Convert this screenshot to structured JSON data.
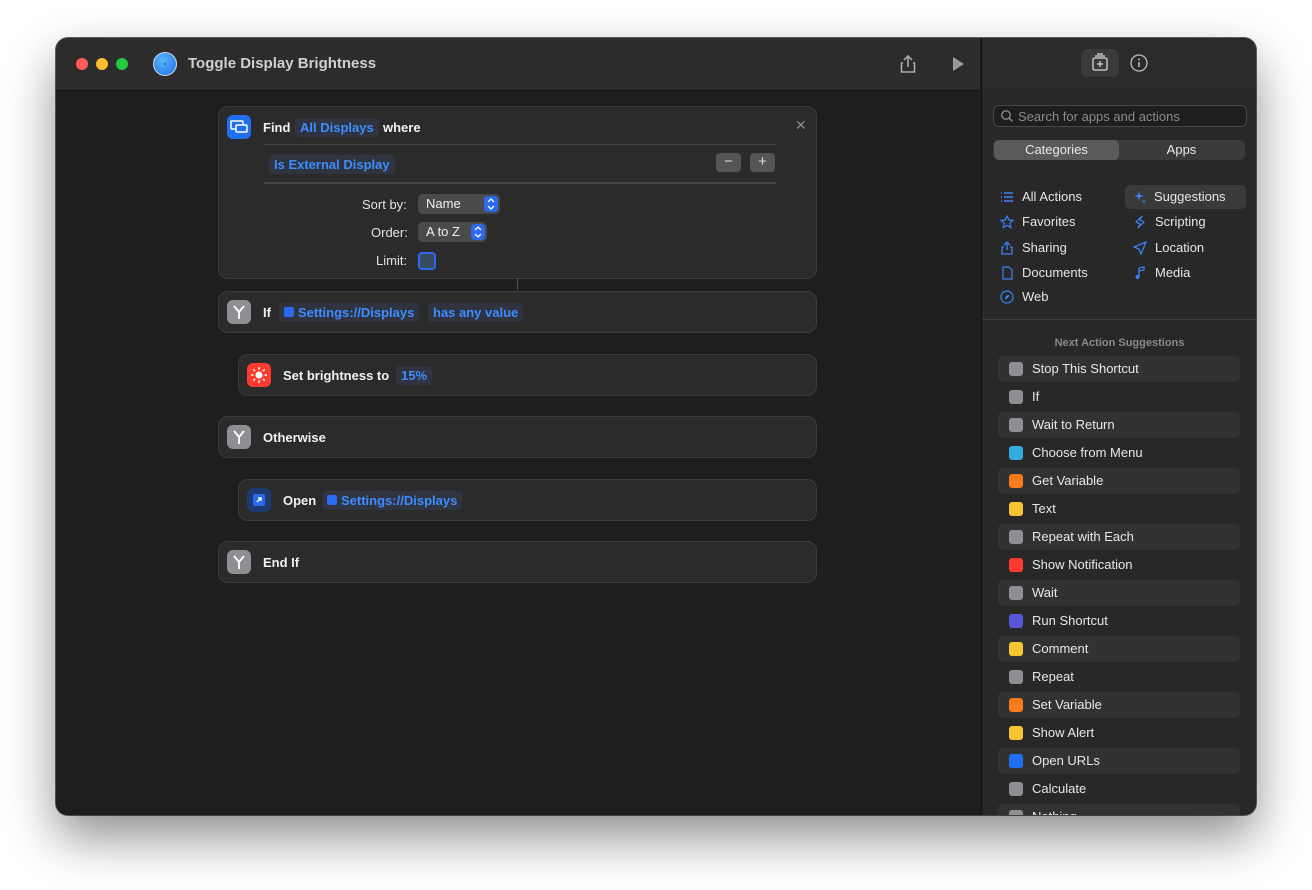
{
  "window": {
    "title": "Toggle Display Brightness"
  },
  "workflow": {
    "find": {
      "keyword": "Find",
      "subject": "All Displays",
      "where": "where",
      "filter": "Is External Display",
      "sort_label": "Sort by:",
      "sort_value": "Name",
      "order_label": "Order:",
      "order_value": "A to Z",
      "limit_label": "Limit:"
    },
    "if_block": {
      "keyword": "If",
      "variable": "Settings://Displays",
      "condition": "has any value"
    },
    "set_brightness": {
      "label": "Set brightness to",
      "value": "15%"
    },
    "otherwise": {
      "keyword": "Otherwise"
    },
    "open": {
      "keyword": "Open",
      "target": "Settings://Displays"
    },
    "end_if": {
      "keyword": "End If"
    }
  },
  "sidebar": {
    "search_placeholder": "Search for apps and actions",
    "tabs": [
      "Categories",
      "Apps"
    ],
    "categories": [
      {
        "label": "All Actions",
        "icon": "list-icon"
      },
      {
        "label": "Suggestions",
        "icon": "sparkle-icon"
      },
      {
        "label": "Favorites",
        "icon": "star-icon"
      },
      {
        "label": "Scripting",
        "icon": "scripting-icon"
      },
      {
        "label": "Sharing",
        "icon": "share-icon"
      },
      {
        "label": "Location",
        "icon": "location-icon"
      },
      {
        "label": "Documents",
        "icon": "document-icon"
      },
      {
        "label": "Media",
        "icon": "music-note-icon"
      },
      {
        "label": "Web",
        "icon": "compass-icon"
      }
    ],
    "suggestions_header": "Next Action Suggestions",
    "suggestions": [
      {
        "label": "Stop This Shortcut",
        "color": "#8e8e93"
      },
      {
        "label": "If",
        "color": "#8e8e93"
      },
      {
        "label": "Wait to Return",
        "color": "#8e8e93"
      },
      {
        "label": "Choose from Menu",
        "color": "#34aadc"
      },
      {
        "label": "Get Variable",
        "color": "#f57b1f"
      },
      {
        "label": "Text",
        "color": "#f7c531"
      },
      {
        "label": "Repeat with Each",
        "color": "#8e8e93"
      },
      {
        "label": "Show Notification",
        "color": "#ff3b30"
      },
      {
        "label": "Wait",
        "color": "#8e8e93"
      },
      {
        "label": "Run Shortcut",
        "color": "#5856d6"
      },
      {
        "label": "Comment",
        "color": "#f7c531"
      },
      {
        "label": "Repeat",
        "color": "#8e8e93"
      },
      {
        "label": "Set Variable",
        "color": "#f57b1f"
      },
      {
        "label": "Show Alert",
        "color": "#f7c531"
      },
      {
        "label": "Open URLs",
        "color": "#1f6ff0"
      },
      {
        "label": "Calculate",
        "color": "#8e8e93"
      },
      {
        "label": "Nothing",
        "color": "#8e8e93"
      }
    ]
  }
}
